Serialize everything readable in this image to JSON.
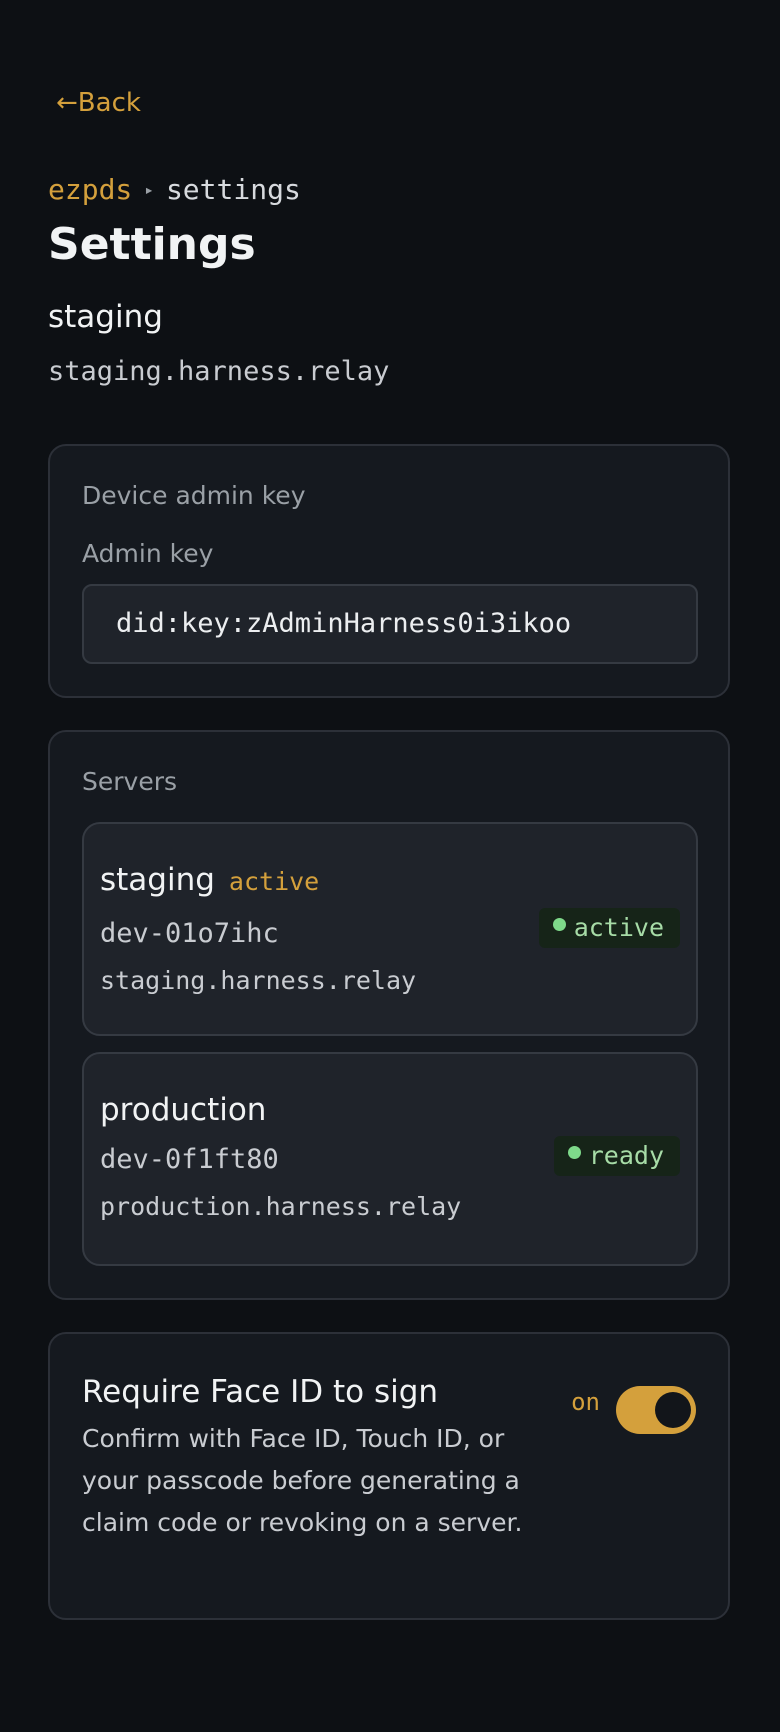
{
  "nav": {
    "back_arrow": "←",
    "back_label": "Back"
  },
  "breadcrumb": {
    "root": "ezpds",
    "separator": "▸",
    "current": "settings"
  },
  "page": {
    "title": "Settings",
    "env_name": "staging",
    "env_host": "staging.harness.relay"
  },
  "admin": {
    "section_label": "Device admin key",
    "field_label": "Admin key",
    "key_value": "did:key:zAdminHarness0i3ikoo"
  },
  "servers": {
    "section_label": "Servers",
    "items": [
      {
        "name": "staging",
        "tag": "active",
        "id": "dev-01o7ihc",
        "host": "staging.harness.relay",
        "status": "active"
      },
      {
        "name": "production",
        "tag": "",
        "id": "dev-0f1ft80",
        "host": "production.harness.relay",
        "status": "ready"
      }
    ]
  },
  "face_id": {
    "title": "Require Face ID to sign",
    "description": "Confirm with Face ID, Touch ID, or your passcode before generating a claim code or revoking on a server.",
    "toggle_state_label": "on",
    "enabled": true
  },
  "colors": {
    "accent": "#d4a03c",
    "status_green": "#7ed98a",
    "background": "#0d1014"
  }
}
